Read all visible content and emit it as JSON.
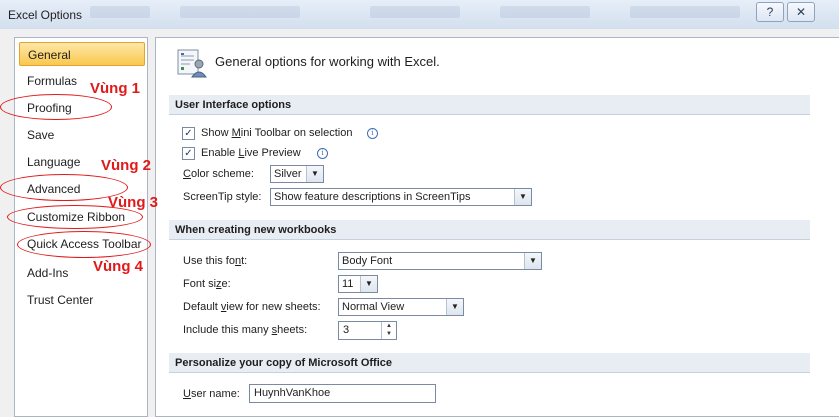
{
  "window": {
    "title": "Excel Options",
    "help_label": "?",
    "close_label": "✕"
  },
  "sidebar": {
    "items": [
      {
        "label": "General",
        "active": true
      },
      {
        "label": "Formulas"
      },
      {
        "label": "Proofing"
      },
      {
        "label": "Save"
      },
      {
        "label": "Language"
      },
      {
        "label": "Advanced"
      },
      {
        "label": "Customize Ribbon"
      },
      {
        "label": "Quick Access Toolbar"
      },
      {
        "label": "Add-Ins"
      },
      {
        "label": "Trust Center"
      }
    ]
  },
  "annotations": [
    "Vùng 1",
    "Vùng 2",
    "Vùng 3",
    "Vùng 4"
  ],
  "content": {
    "header": "General options for working with Excel.",
    "ui_section": {
      "title": "User Interface options",
      "mini_toolbar": {
        "label": "Show Mini Toolbar on selection",
        "checked": true
      },
      "live_preview": {
        "label": "Enable Live Preview",
        "checked": true
      },
      "color_scheme": {
        "label": "Color scheme:",
        "value": "Silver"
      },
      "screentip": {
        "label": "ScreenTip style:",
        "value": "Show feature descriptions in ScreenTips"
      }
    },
    "workbook_section": {
      "title": "When creating new workbooks",
      "font": {
        "label": "Use this font:",
        "value": "Body Font"
      },
      "font_size": {
        "label": "Font size:",
        "value": "11"
      },
      "default_view": {
        "label": "Default view for new sheets:",
        "value": "Normal View"
      },
      "sheets": {
        "label": "Include this many sheets:",
        "value": "3"
      }
    },
    "personalize_section": {
      "title": "Personalize your copy of Microsoft Office",
      "user_name": {
        "label": "User name:",
        "value": "HuynhVanKhoe"
      }
    }
  },
  "colors": {
    "annotation": "#e01a1a",
    "active_nav": "#f9c94d",
    "section_bg": "#e8edf3"
  }
}
